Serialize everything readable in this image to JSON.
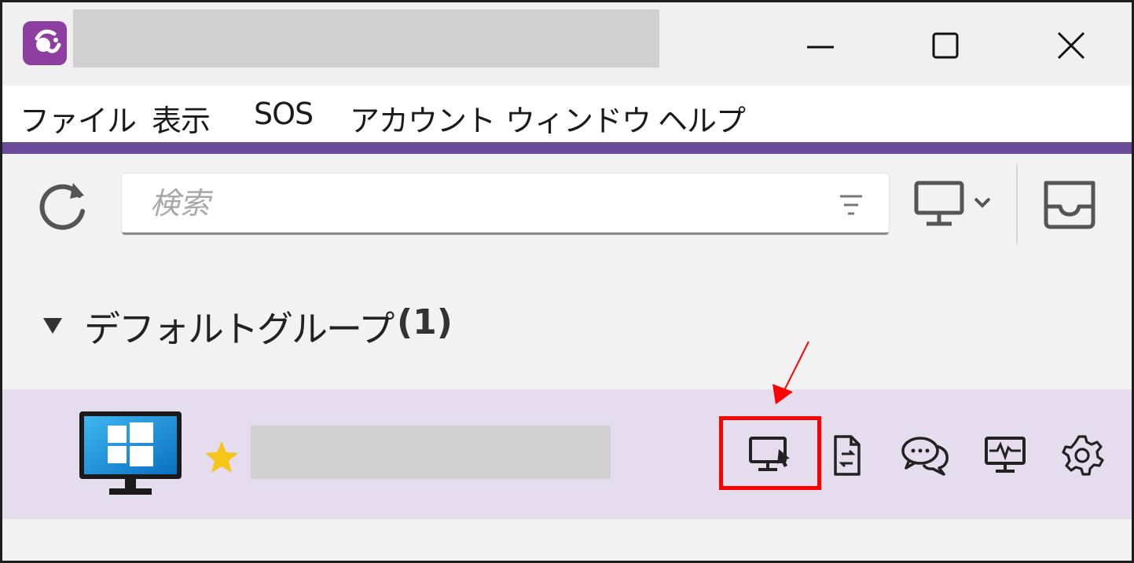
{
  "window": {
    "title": "",
    "controls": {
      "minimize": "minimize-icon",
      "maximize": "maximize-icon",
      "close": "close-icon"
    }
  },
  "menu": {
    "items": [
      "ファイル",
      "表示",
      "SOS",
      "アカウント",
      "ウィンドウ",
      "ヘルプ"
    ]
  },
  "toolbar": {
    "search_placeholder": "検索",
    "icons": [
      "refresh-icon",
      "filter-icon",
      "monitor-dropdown-icon",
      "inbox-icon"
    ]
  },
  "group": {
    "name": "デフォルトグループ",
    "count": "(1)",
    "expanded": true
  },
  "device": {
    "name": "",
    "os_icon": "windows-icon",
    "favorite": true,
    "favorite_color": "#f5c518",
    "actions": [
      "remote-control-icon",
      "file-transfer-icon",
      "chat-icon",
      "monitoring-icon",
      "settings-icon"
    ],
    "highlighted_action": "remote-control-icon"
  },
  "colors": {
    "accent": "#6b4a9a",
    "selected_row": "#e5dced",
    "annotation": "#ff0000",
    "app_icon": "#8e3ea0"
  }
}
